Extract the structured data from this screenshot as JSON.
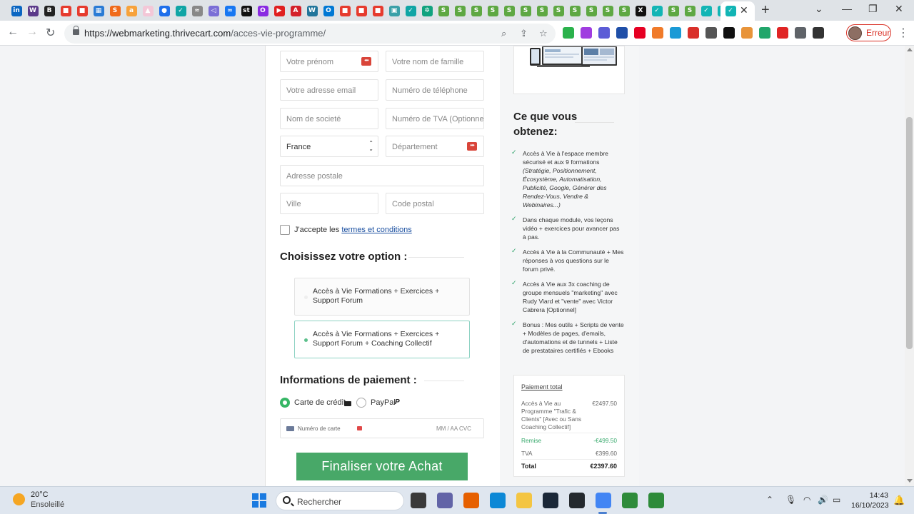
{
  "browser": {
    "tabs": [
      {
        "icon": "linkedin-icon",
        "color": "#0a66c2",
        "glyph": "in"
      },
      {
        "icon": "wizard-icon",
        "color": "#5b3a8a",
        "glyph": "W"
      },
      {
        "icon": "bitcoin-icon",
        "color": "#222222",
        "glyph": "B"
      },
      {
        "icon": "red-square-icon",
        "color": "#e63b2e",
        "glyph": "■"
      },
      {
        "icon": "red-square-icon",
        "color": "#e63b2e",
        "glyph": "■"
      },
      {
        "icon": "blue-grid-icon",
        "color": "#2a7bd5",
        "glyph": "▦"
      },
      {
        "icon": "orange-swirl-icon",
        "color": "#f06a1a",
        "glyph": "S"
      },
      {
        "icon": "amazon-icon",
        "color": "#f7a23b",
        "glyph": "a"
      },
      {
        "icon": "image-icon",
        "color": "#f3c7d7",
        "glyph": "▲"
      },
      {
        "icon": "alien-icon",
        "color": "#1f6feb",
        "glyph": "●"
      },
      {
        "icon": "check-bird-icon",
        "color": "#10a5a5",
        "glyph": "✓"
      },
      {
        "icon": "fan-icon",
        "color": "#888888",
        "glyph": "≈"
      },
      {
        "icon": "telegram-icon",
        "color": "#7b6fd6",
        "glyph": "◁"
      },
      {
        "icon": "meta-icon",
        "color": "#1877f2",
        "glyph": "∞"
      },
      {
        "icon": "st-icon",
        "color": "#111111",
        "glyph": "st"
      },
      {
        "icon": "circle-icon",
        "color": "#8a2be2",
        "glyph": "O"
      },
      {
        "icon": "youtube-icon",
        "color": "#e02020",
        "glyph": "▶"
      },
      {
        "icon": "adobe-icon",
        "color": "#d4202a",
        "glyph": "A"
      },
      {
        "icon": "wordpress-icon",
        "color": "#21759b",
        "glyph": "W"
      },
      {
        "icon": "outlook-icon",
        "color": "#0078d4",
        "glyph": "O"
      },
      {
        "icon": "red-square-icon",
        "color": "#e63b2e",
        "glyph": "■"
      },
      {
        "icon": "red-square-icon",
        "color": "#e63b2e",
        "glyph": "■"
      },
      {
        "icon": "red-square-icon",
        "color": "#e63b2e",
        "glyph": "■"
      },
      {
        "icon": "photo-icon",
        "color": "#3aa0a8",
        "glyph": "▣"
      },
      {
        "icon": "check-bird-icon",
        "color": "#10a5a5",
        "glyph": "✓"
      },
      {
        "icon": "chatgpt-icon",
        "color": "#10a37f",
        "glyph": "✲"
      },
      {
        "icon": "shopify-icon",
        "color": "#5ea843",
        "glyph": "S"
      },
      {
        "icon": "shopify-icon",
        "color": "#5ea843",
        "glyph": "S"
      },
      {
        "icon": "shopify-icon",
        "color": "#5ea843",
        "glyph": "S"
      },
      {
        "icon": "shopify-icon",
        "color": "#5ea843",
        "glyph": "S"
      },
      {
        "icon": "shopify-icon",
        "color": "#5ea843",
        "glyph": "S"
      },
      {
        "icon": "shopify-icon",
        "color": "#5ea843",
        "glyph": "S"
      },
      {
        "icon": "shopify-icon",
        "color": "#5ea843",
        "glyph": "S"
      },
      {
        "icon": "shopify-icon",
        "color": "#5ea843",
        "glyph": "S"
      },
      {
        "icon": "shopify-icon",
        "color": "#5ea843",
        "glyph": "S"
      },
      {
        "icon": "shopify-icon",
        "color": "#5ea843",
        "glyph": "S"
      },
      {
        "icon": "shopify-icon",
        "color": "#5ea843",
        "glyph": "S"
      },
      {
        "icon": "shopify-icon",
        "color": "#5ea843",
        "glyph": "S"
      },
      {
        "icon": "x-icon",
        "color": "#111111",
        "glyph": "X"
      },
      {
        "icon": "teal-bird-icon",
        "color": "#12b5b5",
        "glyph": "✓"
      },
      {
        "icon": "shopify-icon",
        "color": "#5ea843",
        "glyph": "S"
      },
      {
        "icon": "shopify-icon",
        "color": "#5ea843",
        "glyph": "S"
      },
      {
        "icon": "teal-bird-icon",
        "color": "#12b5b5",
        "glyph": "✓"
      },
      {
        "icon": "teal-bird-icon",
        "color": "#12b5b5",
        "glyph": "✓"
      }
    ],
    "close_tab": "✕",
    "new_tab": "+",
    "url_host": "https://webmarketing.thrivecart.com",
    "url_path": "/acces-vie-programme/",
    "profile_status": "Erreur",
    "extensions": [
      {
        "icon": "feedly-icon",
        "color": "#2bb24c"
      },
      {
        "icon": "purple-p-icon",
        "color": "#a03de0"
      },
      {
        "icon": "gear-blue-icon",
        "color": "#5c5cd6"
      },
      {
        "icon": "alien-icon",
        "color": "#1f4fa8"
      },
      {
        "icon": "pinterest-icon",
        "color": "#e60023"
      },
      {
        "icon": "orange-figure-icon",
        "color": "#f07b2a"
      },
      {
        "icon": "blue-tag-icon",
        "color": "#1a9ad6"
      },
      {
        "icon": "red-dots-icon",
        "color": "#d9302a"
      },
      {
        "icon": "off-icon",
        "color": "#555555"
      },
      {
        "icon": "black-circle-icon",
        "color": "#111111"
      },
      {
        "icon": "globe-icon",
        "color": "#e8943a"
      },
      {
        "icon": "green-circle-icon",
        "color": "#21a66b"
      },
      {
        "icon": "red-shield-icon",
        "color": "#e02424"
      },
      {
        "icon": "puzzle-icon",
        "color": "#5f6368"
      },
      {
        "icon": "sidebar-icon",
        "color": "#333333"
      }
    ]
  },
  "form": {
    "first_name_placeholder": "Votre prénom",
    "last_name_placeholder": "Votre nom de famille",
    "email_placeholder": "Votre adresse email",
    "phone_placeholder": "Numéro de téléphone",
    "company_placeholder": "Nom de societé",
    "vat_placeholder": "Numéro de TVA (Optionnel)",
    "country_value": "France",
    "department_placeholder": "Département",
    "address_placeholder": "Adresse postale",
    "city_placeholder": "Ville",
    "postal_placeholder": "Code postal",
    "terms_prefix": "J'accepte les",
    "terms_link": "termes et conditions"
  },
  "options": {
    "heading": "Choisissez votre option :",
    "items": [
      {
        "label": "Accès à Vie Formations + Exercices + Support Forum",
        "selected": false
      },
      {
        "label": "Accès à Vie Formations + Exercices + Support Forum + Coaching Collectif",
        "selected": true
      }
    ]
  },
  "payment": {
    "heading": "Informations de paiement :",
    "method_card": "Carte de crédit",
    "method_paypal": "PayPal",
    "card_number_placeholder": "Numéro de carte",
    "card_expiry_cvc": "MM / AA  CVC",
    "submit_label": "Finaliser votre Achat"
  },
  "sidebar": {
    "title": "Ce que vous obtenez:",
    "benefits": [
      {
        "text": "Accès à Vie à l'espace membre sécurisé et aux 9 formations",
        "italic": "(Stratégie, Positionnement, Écosystème, Automatisation, Publicité, Google, Générer des Rendez-Vous, Vendre & Webinaires...)"
      },
      {
        "text": "Dans chaque module, vos leçons vidéo + exercices pour avancer pas à pas.",
        "italic": ""
      },
      {
        "text": "Accès à Vie à la Communauté + Mes réponses à vos questions sur le forum privé.",
        "italic": ""
      },
      {
        "text": "Accès à Vie aux 3x coaching de groupe mensuels \"marketing\" avec Rudy Viard et \"vente\" avec Victor Cabrera [Optionnel]",
        "italic": ""
      },
      {
        "text": "Bonus : Mes outils + Scripts de vente + Modèles de pages, d'emails, d'automations et de tunnels + Liste de prestataires certifiés + Ebooks",
        "italic": ""
      }
    ],
    "summary": {
      "title": "Paiement total",
      "item_label": "Accès à Vie au Programme \"Trafic & Clients\" [Avec ou Sans Coaching Collectif]",
      "item_price": "€2497.50",
      "discount_label": "Remise",
      "discount_value": "-€499.50",
      "tax_label": "TVA",
      "tax_value": "€399.60",
      "total_label": "Total",
      "total_value": "€2397.60"
    }
  },
  "taskbar": {
    "temperature": "20°C",
    "weather": "Ensoleillé",
    "search_placeholder": "Rechercher",
    "time": "14:43",
    "date": "16/10/2023",
    "apps": [
      {
        "icon": "file-explorer-dark-icon",
        "color": "#3a3a3a"
      },
      {
        "icon": "teams-icon",
        "color": "#6264a7"
      },
      {
        "icon": "firefox-icon",
        "color": "#e66000"
      },
      {
        "icon": "edge-icon",
        "color": "#0c88d6"
      },
      {
        "icon": "folder-icon",
        "color": "#f4c542"
      },
      {
        "icon": "steam-icon",
        "color": "#1b2838"
      },
      {
        "icon": "github-icon",
        "color": "#24292e"
      },
      {
        "icon": "chrome-icon",
        "color": "#4285f4"
      },
      {
        "icon": "green-c-icon",
        "color": "#2e8b3a"
      },
      {
        "icon": "green-c-icon",
        "color": "#2e8b3a"
      }
    ]
  }
}
